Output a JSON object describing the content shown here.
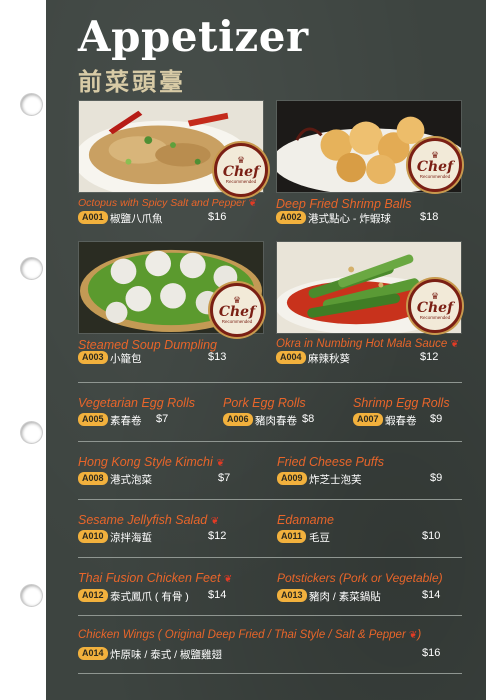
{
  "header": {
    "title": "Appetizer",
    "subtitle": "前菜頭臺"
  },
  "colors": {
    "accent_orange": "#e8652a",
    "code_gold": "#f2b13d",
    "page_bg": "#3d4440"
  },
  "badge": {
    "label": "Chef",
    "caption": "Recommended"
  },
  "featured": [
    {
      "name": "Octopus with Spicy Salt and Pepper",
      "code": "A001",
      "chinese": "椒鹽八爪魚",
      "price": "$16",
      "spicy": true
    },
    {
      "name": "Deep Fried Shrimp Balls",
      "code": "A002",
      "chinese": "港式點心 - 炸蝦球",
      "price": "$18",
      "spicy": false
    },
    {
      "name": "Steamed Soup Dumpling",
      "code": "A003",
      "chinese": "小籠包",
      "price": "$13",
      "spicy": false
    },
    {
      "name": "Okra in Numbing Hot Mala Sauce",
      "code": "A004",
      "chinese": "麻辣秋葵",
      "price": "$12",
      "spicy": true
    }
  ],
  "items": [
    {
      "name": "Vegetarian Egg Rolls",
      "code": "A005",
      "chinese": "素春卷",
      "price": "$7"
    },
    {
      "name": "Pork Egg Rolls",
      "code": "A006",
      "chinese": "豬肉春卷",
      "price": "$8"
    },
    {
      "name": "Shrimp Egg Rolls",
      "code": "A007",
      "chinese": "蝦春卷",
      "price": "$9"
    },
    {
      "name": "Hong Kong Style Kimchi",
      "code": "A008",
      "chinese": "港式泡菜",
      "price": "$7",
      "spicy": true
    },
    {
      "name": "Fried Cheese Puffs",
      "code": "A009",
      "chinese": "炸芝士泡芙",
      "price": "$9"
    },
    {
      "name": "Sesame Jellyfish Salad",
      "code": "A010",
      "chinese": "涼拌海蜇",
      "price": "$12",
      "spicy": true
    },
    {
      "name": "Edamame",
      "code": "A011",
      "chinese": "毛豆",
      "price": "$10"
    },
    {
      "name": "Thai Fusion Chicken Feet",
      "code": "A012",
      "chinese": "泰式鳳爪 ( 有骨 )",
      "price": "$14",
      "spicy": true
    },
    {
      "name": "Potstickers (Pork or Vegetable)",
      "code": "A013",
      "chinese": "豬肉 / 素菜鍋貼",
      "price": "$14"
    },
    {
      "name": "Chicken Wings ( Original Deep Fried / Thai Style / Salt & Pepper",
      "name_end": ")",
      "code": "A014",
      "chinese": "炸原味 / 泰式 / 椒鹽雞翅",
      "price": "$16",
      "spicy": true
    }
  ],
  "chili_glyph": "❦"
}
